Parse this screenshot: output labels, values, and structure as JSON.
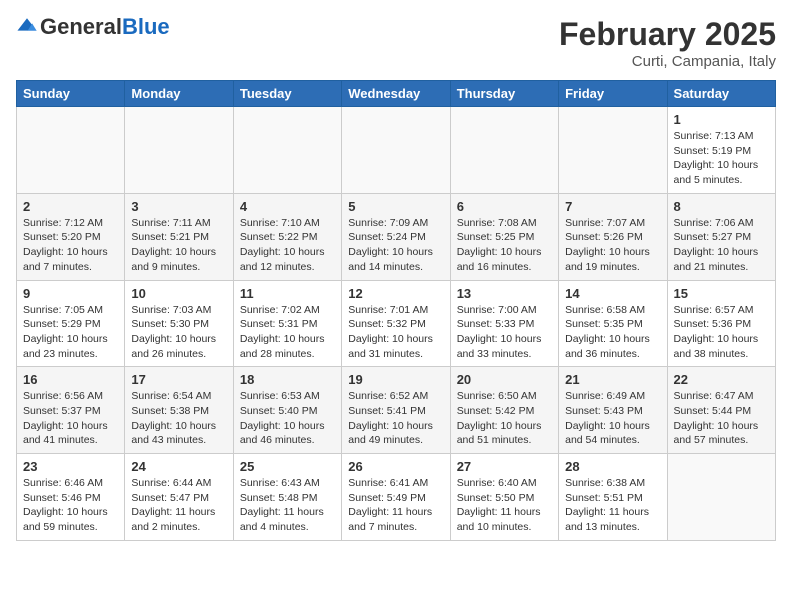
{
  "header": {
    "logo_general": "General",
    "logo_blue": "Blue",
    "month_title": "February 2025",
    "location": "Curti, Campania, Italy"
  },
  "days_of_week": [
    "Sunday",
    "Monday",
    "Tuesday",
    "Wednesday",
    "Thursday",
    "Friday",
    "Saturday"
  ],
  "weeks": [
    {
      "days": [
        {
          "date": "",
          "info": ""
        },
        {
          "date": "",
          "info": ""
        },
        {
          "date": "",
          "info": ""
        },
        {
          "date": "",
          "info": ""
        },
        {
          "date": "",
          "info": ""
        },
        {
          "date": "",
          "info": ""
        },
        {
          "date": "1",
          "info": "Sunrise: 7:13 AM\nSunset: 5:19 PM\nDaylight: 10 hours\nand 5 minutes."
        }
      ]
    },
    {
      "days": [
        {
          "date": "2",
          "info": "Sunrise: 7:12 AM\nSunset: 5:20 PM\nDaylight: 10 hours\nand 7 minutes."
        },
        {
          "date": "3",
          "info": "Sunrise: 7:11 AM\nSunset: 5:21 PM\nDaylight: 10 hours\nand 9 minutes."
        },
        {
          "date": "4",
          "info": "Sunrise: 7:10 AM\nSunset: 5:22 PM\nDaylight: 10 hours\nand 12 minutes."
        },
        {
          "date": "5",
          "info": "Sunrise: 7:09 AM\nSunset: 5:24 PM\nDaylight: 10 hours\nand 14 minutes."
        },
        {
          "date": "6",
          "info": "Sunrise: 7:08 AM\nSunset: 5:25 PM\nDaylight: 10 hours\nand 16 minutes."
        },
        {
          "date": "7",
          "info": "Sunrise: 7:07 AM\nSunset: 5:26 PM\nDaylight: 10 hours\nand 19 minutes."
        },
        {
          "date": "8",
          "info": "Sunrise: 7:06 AM\nSunset: 5:27 PM\nDaylight: 10 hours\nand 21 minutes."
        }
      ]
    },
    {
      "days": [
        {
          "date": "9",
          "info": "Sunrise: 7:05 AM\nSunset: 5:29 PM\nDaylight: 10 hours\nand 23 minutes."
        },
        {
          "date": "10",
          "info": "Sunrise: 7:03 AM\nSunset: 5:30 PM\nDaylight: 10 hours\nand 26 minutes."
        },
        {
          "date": "11",
          "info": "Sunrise: 7:02 AM\nSunset: 5:31 PM\nDaylight: 10 hours\nand 28 minutes."
        },
        {
          "date": "12",
          "info": "Sunrise: 7:01 AM\nSunset: 5:32 PM\nDaylight: 10 hours\nand 31 minutes."
        },
        {
          "date": "13",
          "info": "Sunrise: 7:00 AM\nSunset: 5:33 PM\nDaylight: 10 hours\nand 33 minutes."
        },
        {
          "date": "14",
          "info": "Sunrise: 6:58 AM\nSunset: 5:35 PM\nDaylight: 10 hours\nand 36 minutes."
        },
        {
          "date": "15",
          "info": "Sunrise: 6:57 AM\nSunset: 5:36 PM\nDaylight: 10 hours\nand 38 minutes."
        }
      ]
    },
    {
      "days": [
        {
          "date": "16",
          "info": "Sunrise: 6:56 AM\nSunset: 5:37 PM\nDaylight: 10 hours\nand 41 minutes."
        },
        {
          "date": "17",
          "info": "Sunrise: 6:54 AM\nSunset: 5:38 PM\nDaylight: 10 hours\nand 43 minutes."
        },
        {
          "date": "18",
          "info": "Sunrise: 6:53 AM\nSunset: 5:40 PM\nDaylight: 10 hours\nand 46 minutes."
        },
        {
          "date": "19",
          "info": "Sunrise: 6:52 AM\nSunset: 5:41 PM\nDaylight: 10 hours\nand 49 minutes."
        },
        {
          "date": "20",
          "info": "Sunrise: 6:50 AM\nSunset: 5:42 PM\nDaylight: 10 hours\nand 51 minutes."
        },
        {
          "date": "21",
          "info": "Sunrise: 6:49 AM\nSunset: 5:43 PM\nDaylight: 10 hours\nand 54 minutes."
        },
        {
          "date": "22",
          "info": "Sunrise: 6:47 AM\nSunset: 5:44 PM\nDaylight: 10 hours\nand 57 minutes."
        }
      ]
    },
    {
      "days": [
        {
          "date": "23",
          "info": "Sunrise: 6:46 AM\nSunset: 5:46 PM\nDaylight: 10 hours\nand 59 minutes."
        },
        {
          "date": "24",
          "info": "Sunrise: 6:44 AM\nSunset: 5:47 PM\nDaylight: 11 hours\nand 2 minutes."
        },
        {
          "date": "25",
          "info": "Sunrise: 6:43 AM\nSunset: 5:48 PM\nDaylight: 11 hours\nand 4 minutes."
        },
        {
          "date": "26",
          "info": "Sunrise: 6:41 AM\nSunset: 5:49 PM\nDaylight: 11 hours\nand 7 minutes."
        },
        {
          "date": "27",
          "info": "Sunrise: 6:40 AM\nSunset: 5:50 PM\nDaylight: 11 hours\nand 10 minutes."
        },
        {
          "date": "28",
          "info": "Sunrise: 6:38 AM\nSunset: 5:51 PM\nDaylight: 11 hours\nand 13 minutes."
        },
        {
          "date": "",
          "info": ""
        }
      ]
    }
  ]
}
